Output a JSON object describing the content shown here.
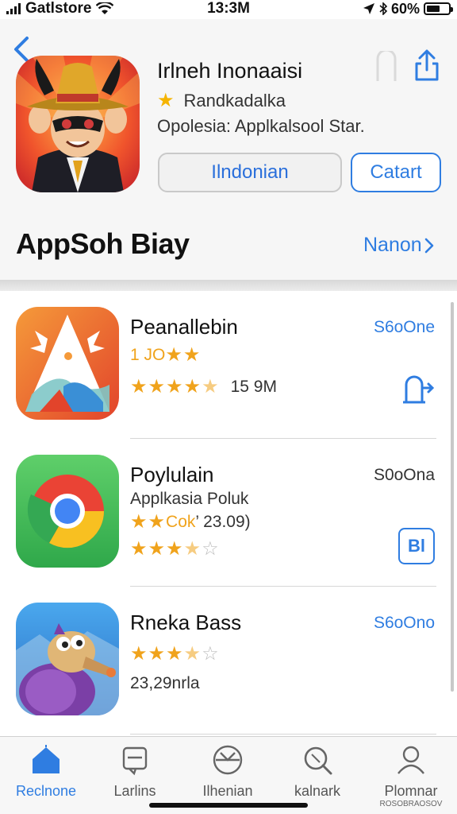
{
  "status_bar": {
    "carrier": "Gatlstore",
    "time": "13:3M",
    "battery": "60%",
    "battery_level": 0.6
  },
  "header": {
    "back_icon": "chevron-left-icon",
    "share_icon": "share-icon",
    "featured": {
      "title": "Irlneh Inonaaisi",
      "rating_text": "Randkadalka",
      "subtitle": "Opolesia: Applkalsool Star.",
      "primary_button": "Ilndonian",
      "secondary_button": "Catart"
    },
    "section_title": "AppSoh Biay",
    "section_link": "Nanon"
  },
  "apps": [
    {
      "name": "Peanallebin",
      "price": "S6oOne",
      "line1": "1 JO",
      "line1_stars": "★★",
      "rating_count": "15 9M",
      "stars_filled": 4.5,
      "action_icon": "open-app-icon"
    },
    {
      "name": "Poylulain",
      "price": "S0oOna",
      "line1": "Applkasia Poluk",
      "line2_prefix": "★★",
      "line2_accent": "Cok",
      "line2_rest": "’ 23.09)",
      "stars_filled": 3.5,
      "action_icon": "book-icon",
      "action_label": "Bl"
    },
    {
      "name": "Rneka Bass",
      "price": "S6oOno",
      "rating_count": "23,29nrla",
      "stars_filled": 3.5
    }
  ],
  "tabs": [
    {
      "label": "Reclnone",
      "icon": "home-icon",
      "active": true
    },
    {
      "label": "Larlins",
      "icon": "inbox-icon",
      "active": false
    },
    {
      "label": "Ilhenian",
      "icon": "compass-icon",
      "active": false
    },
    {
      "label": "kalnark",
      "icon": "search-icon",
      "active": false
    },
    {
      "label": "Plomnar",
      "sublabel": "ROSOBRAOSOV",
      "icon": "person-icon",
      "active": false
    }
  ],
  "colors": {
    "accent_blue": "#2f7de1",
    "star_orange": "#f0a31c",
    "star_yellow": "#f5b400"
  }
}
